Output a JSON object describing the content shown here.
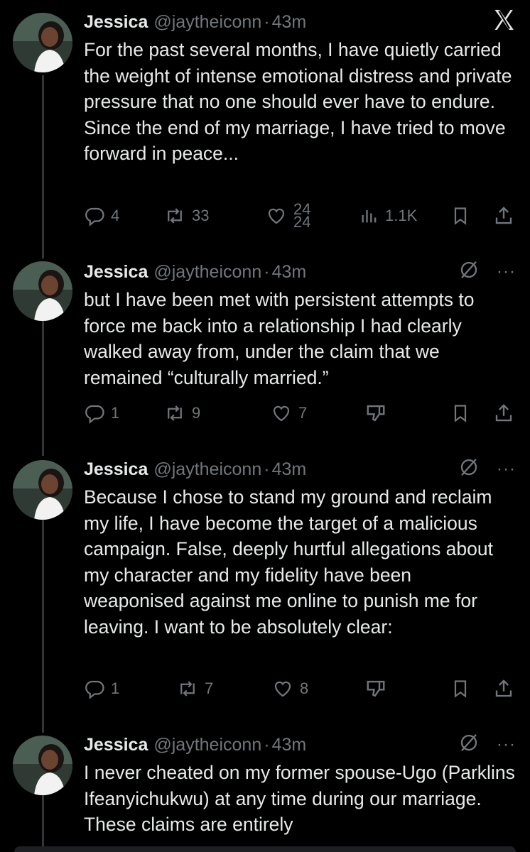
{
  "close_label": "X",
  "tweets": [
    {
      "name": "Jessica",
      "handle": "@jaytheiconn",
      "separator": "·",
      "time": "43m",
      "text": "For the past several months, I have quietly carried the weight of intense emotional distress and private pressure that no one should ever have to endure.\nSince the end of my marriage, I have tried to move forward in peace...",
      "replies": "4",
      "reposts": "33",
      "likes_top": "24",
      "likes_bottom": "24",
      "views": "1.1K"
    },
    {
      "name": "Jessica",
      "handle": "@jaytheiconn",
      "separator": "·",
      "time": "43m",
      "more": "···",
      "text": "but I have been met with persistent attempts to force me back into a relationship I had clearly walked away from, under the claim that we remained “culturally married.”",
      "replies": "1",
      "reposts": "9",
      "likes": "7"
    },
    {
      "name": "Jessica",
      "handle": "@jaytheiconn",
      "separator": "·",
      "time": "43m",
      "more": "···",
      "text": "Because I chose to stand my ground and reclaim my life, I have become the target of a malicious campaign. False, deeply hurtful allegations about my character and my fidelity have been weaponised against me online to punish me for leaving. I want to be absolutely clear:",
      "replies": "1",
      "reposts": "7",
      "likes": "8"
    },
    {
      "name": "Jessica",
      "handle": "@jaytheiconn",
      "separator": "·",
      "time": "43m",
      "more": "···",
      "text": "I never cheated on my former spouse-Ugo (Parklins Ifeanyichukwu) at any time during our marriage. These claims are entirely"
    }
  ],
  "icons": {
    "reply": "reply-icon",
    "repost": "repost-icon",
    "like": "heart-icon",
    "views": "views-icon",
    "bookmark": "bookmark-icon",
    "share": "share-icon",
    "dislike": "downvote-icon",
    "grok": "grok-icon"
  }
}
